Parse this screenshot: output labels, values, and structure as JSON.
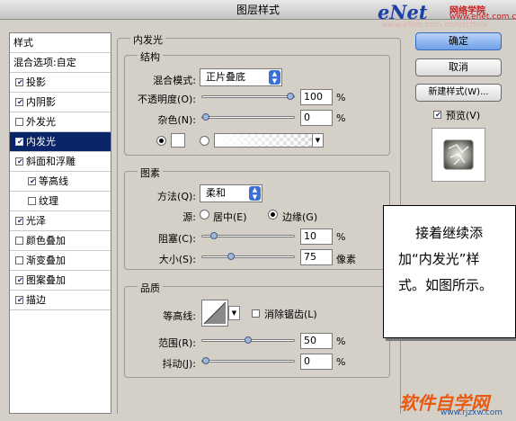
{
  "window": {
    "title": "图层样式"
  },
  "watermark": {
    "brand": "eNet",
    "cn": "网络学院",
    "url": "www.enet.com.cn",
    "faint_url": "www.eNet.com.cn/eschool"
  },
  "sidebar": {
    "header": "样式",
    "blend_options": "混合选项:自定",
    "items": [
      {
        "label": "投影",
        "checked": true,
        "selected": false,
        "indent": false
      },
      {
        "label": "内阴影",
        "checked": true,
        "selected": false,
        "indent": false
      },
      {
        "label": "外发光",
        "checked": false,
        "selected": false,
        "indent": false
      },
      {
        "label": "内发光",
        "checked": true,
        "selected": true,
        "indent": false
      },
      {
        "label": "斜面和浮雕",
        "checked": true,
        "selected": false,
        "indent": false
      },
      {
        "label": "等高线",
        "checked": true,
        "selected": false,
        "indent": true
      },
      {
        "label": "纹理",
        "checked": false,
        "selected": false,
        "indent": true
      },
      {
        "label": "光泽",
        "checked": true,
        "selected": false,
        "indent": false
      },
      {
        "label": "颜色叠加",
        "checked": false,
        "selected": false,
        "indent": false
      },
      {
        "label": "渐变叠加",
        "checked": false,
        "selected": false,
        "indent": false
      },
      {
        "label": "图案叠加",
        "checked": true,
        "selected": false,
        "indent": false
      },
      {
        "label": "描边",
        "checked": true,
        "selected": false,
        "indent": false
      }
    ]
  },
  "panel": {
    "title": "内发光",
    "structure": {
      "title": "结构",
      "blend_mode_label": "混合模式:",
      "blend_mode_value": "正片叠底",
      "opacity_label": "不透明度(O):",
      "opacity_value": "100",
      "opacity_level": 1.0,
      "noise_label": "杂色(N):",
      "noise_value": "0",
      "noise_level": 0.0,
      "percent": "%",
      "color_mode": "solid"
    },
    "elements": {
      "title": "图素",
      "method_label": "方法(Q):",
      "method_value": "柔和",
      "source_label": "源:",
      "source_center": "居中(E)",
      "source_edge": "边缘(G)",
      "source_selected": "edge",
      "choke_label": "阻塞(C):",
      "choke_value": "10",
      "choke_level": 0.1,
      "size_label": "大小(S):",
      "size_value": "75",
      "size_level": 0.3,
      "size_unit": "像素",
      "percent": "%"
    },
    "quality": {
      "title": "品质",
      "contour_label": "等高线:",
      "antialias_label": "消除锯齿(L)",
      "antialias_checked": false,
      "range_label": "范围(R):",
      "range_value": "50",
      "range_level": 0.5,
      "jitter_label": "抖动(J):",
      "jitter_value": "0",
      "jitter_level": 0.0,
      "percent": "%"
    }
  },
  "buttons": {
    "ok": "确定",
    "cancel": "取消",
    "new_style": "新建样式(W)...",
    "preview_label": "预览(V)",
    "preview_checked": true
  },
  "note": {
    "text": "    接着继续添加“内发光”样式。如图所示。"
  },
  "footer": {
    "logo": "软件自学网",
    "url": "www.rjzxw.com"
  },
  "colors": {
    "selected": "#0a246a",
    "accent": "#3b6fd6",
    "brand_blue": "#1c3fa8",
    "brand_red": "#c81c1c"
  }
}
